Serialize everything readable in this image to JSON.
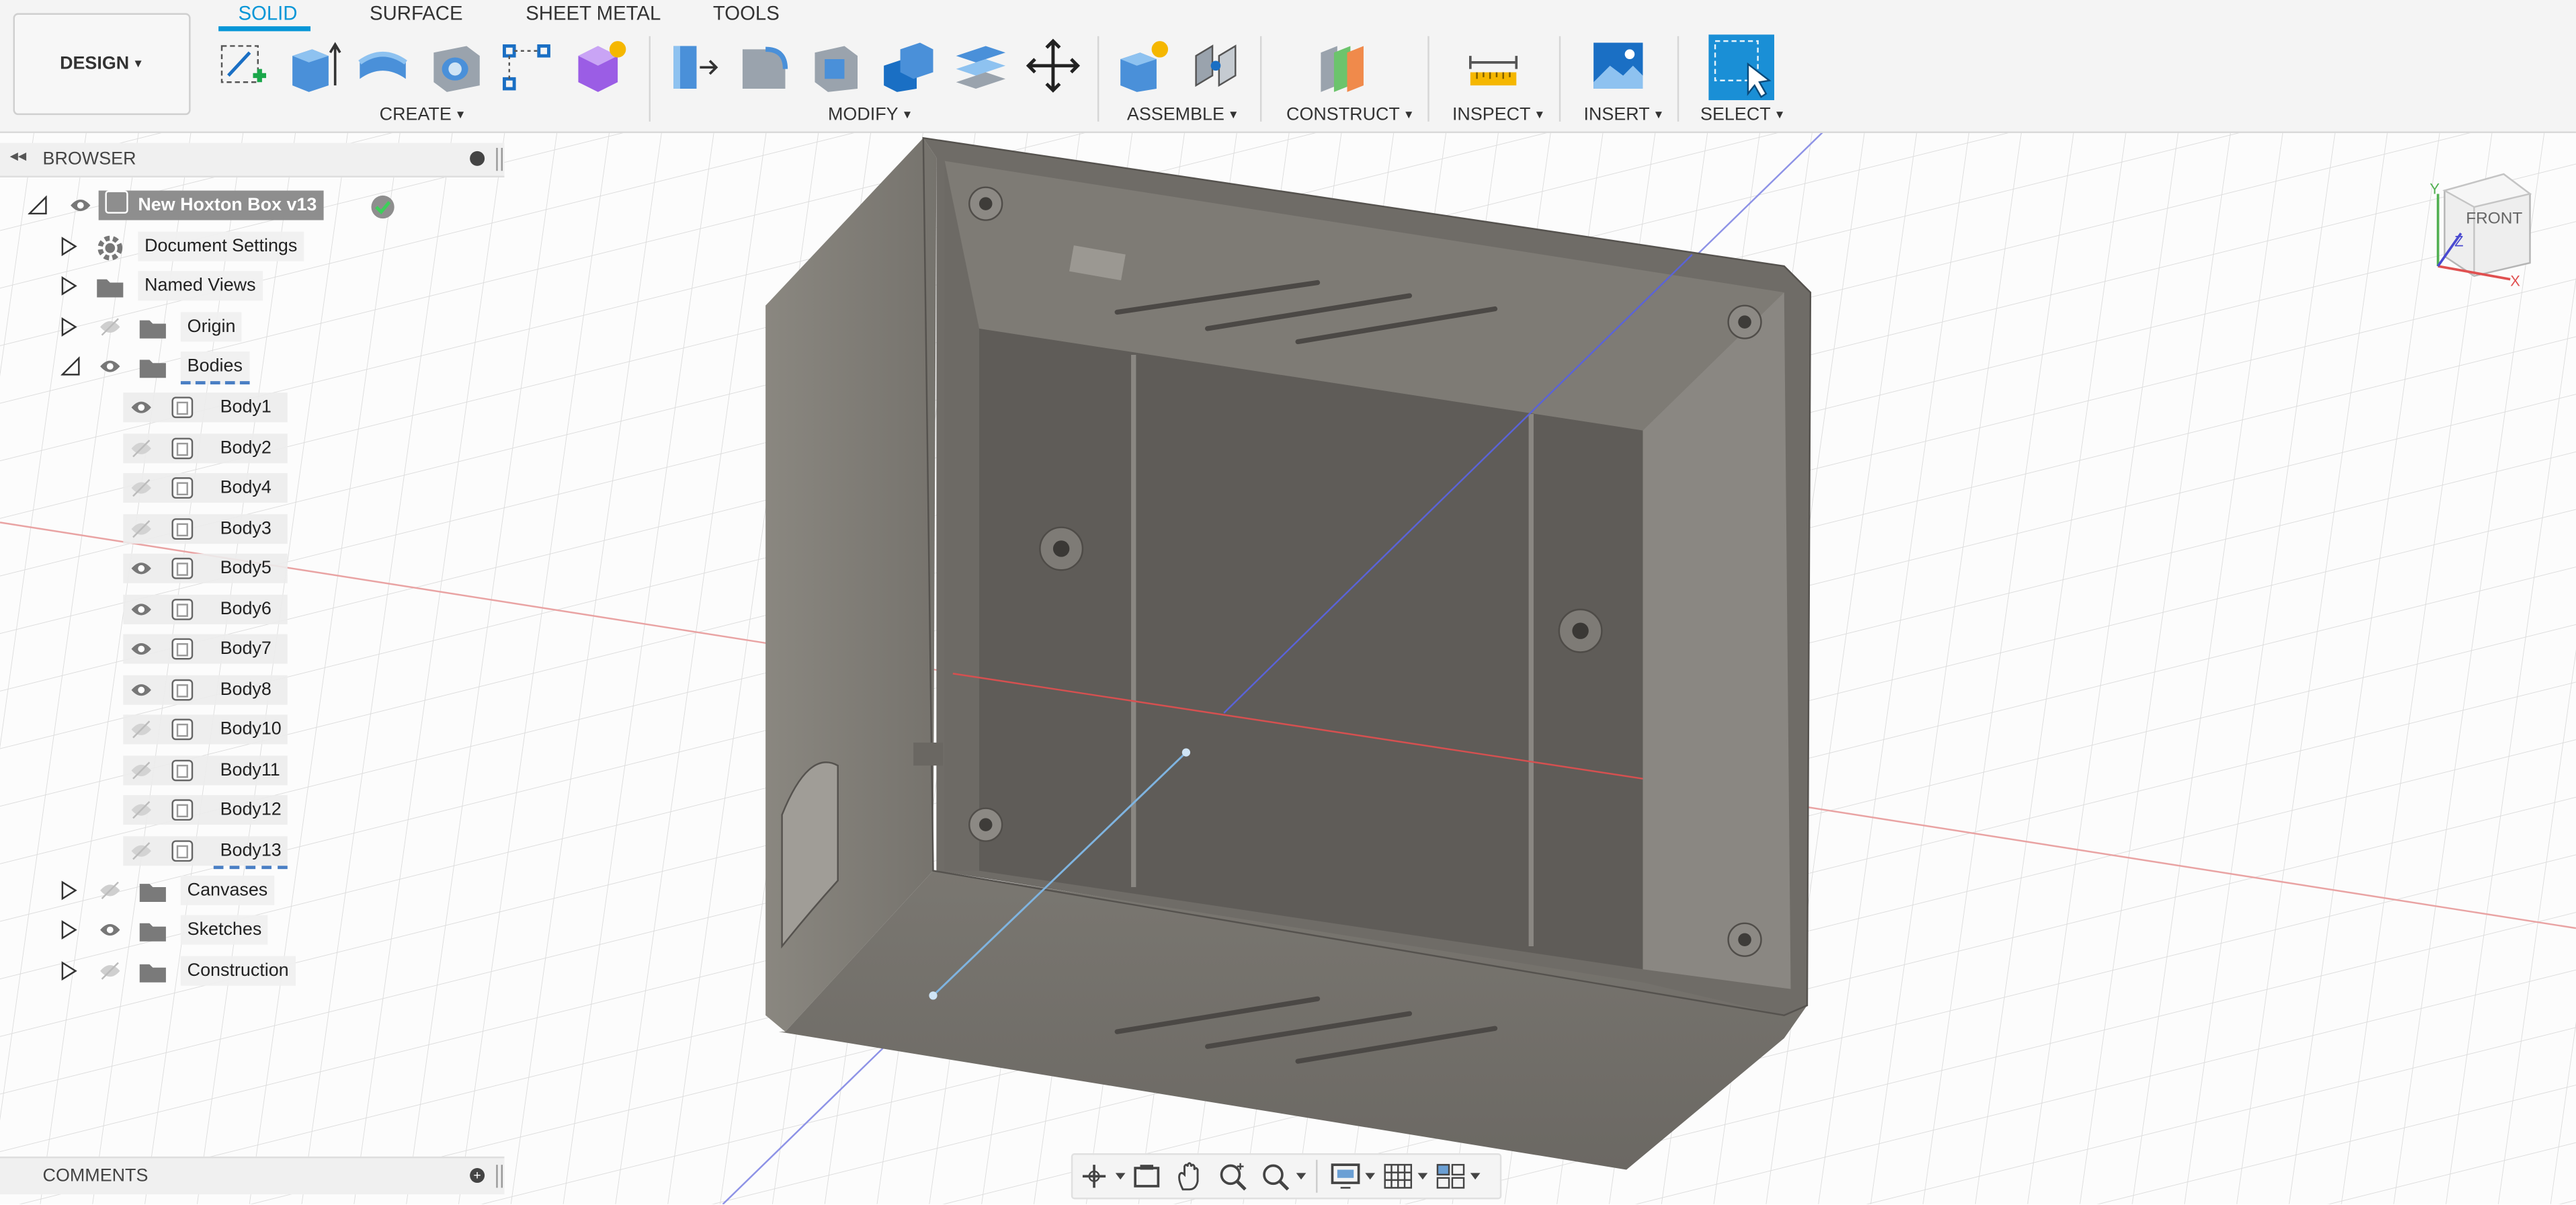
{
  "workspace": {
    "label": "DESIGN"
  },
  "tabs": [
    {
      "label": "SOLID"
    },
    {
      "label": "SURFACE"
    },
    {
      "label": "SHEET METAL"
    },
    {
      "label": "TOOLS"
    }
  ],
  "groups": {
    "create": "CREATE",
    "modify": "MODIFY",
    "assemble": "ASSEMBLE",
    "construct": "CONSTRUCT",
    "inspect": "INSPECT",
    "insert": "INSERT",
    "select": "SELECT"
  },
  "browser": {
    "title": "BROWSER",
    "root": "New Hoxton Box v13",
    "items": [
      {
        "label": "Document Settings",
        "icon": "gear-icon"
      },
      {
        "label": "Named Views",
        "icon": "folder-icon"
      },
      {
        "label": "Origin",
        "icon": "folder-icon",
        "visible": false
      },
      {
        "label": "Bodies",
        "icon": "folder-icon",
        "visible": true,
        "expanded": true
      },
      {
        "label": "Canvases",
        "icon": "folder-icon",
        "visible": false
      },
      {
        "label": "Sketches",
        "icon": "folder-icon",
        "visible": true
      },
      {
        "label": "Construction",
        "icon": "folder-icon",
        "visible": false
      }
    ],
    "bodies": [
      {
        "label": "Body1",
        "visible": true
      },
      {
        "label": "Body2",
        "visible": false
      },
      {
        "label": "Body4",
        "visible": false
      },
      {
        "label": "Body3",
        "visible": false
      },
      {
        "label": "Body5",
        "visible": true
      },
      {
        "label": "Body6",
        "visible": true
      },
      {
        "label": "Body7",
        "visible": true
      },
      {
        "label": "Body8",
        "visible": true
      },
      {
        "label": "Body10",
        "visible": false
      },
      {
        "label": "Body11",
        "visible": false
      },
      {
        "label": "Body12",
        "visible": false
      },
      {
        "label": "Body13",
        "visible": false
      }
    ]
  },
  "comments": {
    "title": "COMMENTS"
  },
  "viewcube": {
    "face": "FRONT",
    "x_axis": "X",
    "y_axis": "Y",
    "z_axis": "Z"
  },
  "colors": {
    "accent": "#0696d7",
    "model": "#7d7a74",
    "x_axis": "#e06060",
    "z_axis": "#5a63d8"
  }
}
